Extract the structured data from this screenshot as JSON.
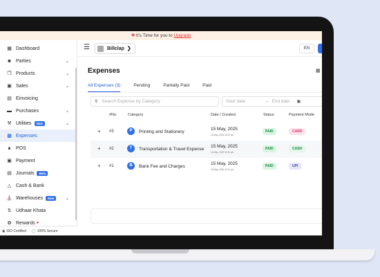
{
  "banner": {
    "prefix": "It's Time for you to ",
    "link": "Upgrade"
  },
  "sidebar": {
    "items": [
      {
        "label": "Dashboard",
        "icon": "dashboard-icon",
        "chevron": false
      },
      {
        "label": "Parties",
        "icon": "users-icon",
        "chevron": true
      },
      {
        "label": "Products",
        "icon": "box-icon",
        "chevron": true
      },
      {
        "label": "Sales",
        "icon": "document-icon",
        "chevron": true
      },
      {
        "label": "Einvoicing",
        "icon": "invoice-icon",
        "chevron": false
      },
      {
        "label": "Purchases",
        "icon": "purchase-icon",
        "chevron": true
      },
      {
        "label": "Utilities",
        "icon": "tools-icon",
        "chevron": true,
        "badge": "New"
      },
      {
        "label": "Expenses",
        "icon": "expense-icon",
        "chevron": false,
        "active": true
      },
      {
        "label": "POS",
        "icon": "pos-icon",
        "chevron": false
      },
      {
        "label": "Payment",
        "icon": "payment-icon",
        "chevron": false
      },
      {
        "label": "Journals",
        "icon": "journal-icon",
        "chevron": false,
        "badge": "Beta"
      },
      {
        "label": "Cash & Bank",
        "icon": "bank-icon",
        "chevron": false
      },
      {
        "label": "Warehouses",
        "icon": "warehouse-icon",
        "chevron": true,
        "badge": "New"
      },
      {
        "label": "Udhaar Khata",
        "icon": "ledger-icon",
        "chevron": false
      },
      {
        "label": "Rewards",
        "icon": "gift-icon",
        "chevron": false
      }
    ],
    "footer": {
      "iso": "ISO Certified",
      "secure": "100% Secure"
    }
  },
  "topbar": {
    "company": "Billclap",
    "language": "EN"
  },
  "page": {
    "title": "Expenses",
    "tabs": [
      "All Expenses (3)",
      "Pending",
      "Partially Paid",
      "Paid"
    ],
    "search_placeholder": "Search Expense by Category",
    "start_date": "Start date",
    "end_date": "End date"
  },
  "table": {
    "headers": [
      "#No.",
      "Category",
      "Date / Created",
      "Status",
      "Payment Mode"
    ],
    "rows": [
      {
        "no": "#3",
        "initial": "P",
        "category": "Printing and Stationery",
        "date": "15 May, 2025",
        "created": "15 May, 2025 02:42 pm",
        "status": "PAID",
        "mode": "CARD"
      },
      {
        "no": "#2",
        "initial": "T",
        "category": "Transportation & Travel Expense",
        "date": "15 May, 2025",
        "created": "15 May, 2025 02:40 pm",
        "status": "PAID",
        "mode": "CASH"
      },
      {
        "no": "#1",
        "initial": "B",
        "category": "Bank Fee and Charges",
        "date": "15 May, 2025",
        "created": "15 May, 2025 02:31 pm",
        "status": "PAID",
        "mode": "UPI"
      }
    ]
  },
  "colors": {
    "accent": "#1e5bd8",
    "brand_blue": "#2f6fe8",
    "paid_green": "#1a8a45"
  }
}
